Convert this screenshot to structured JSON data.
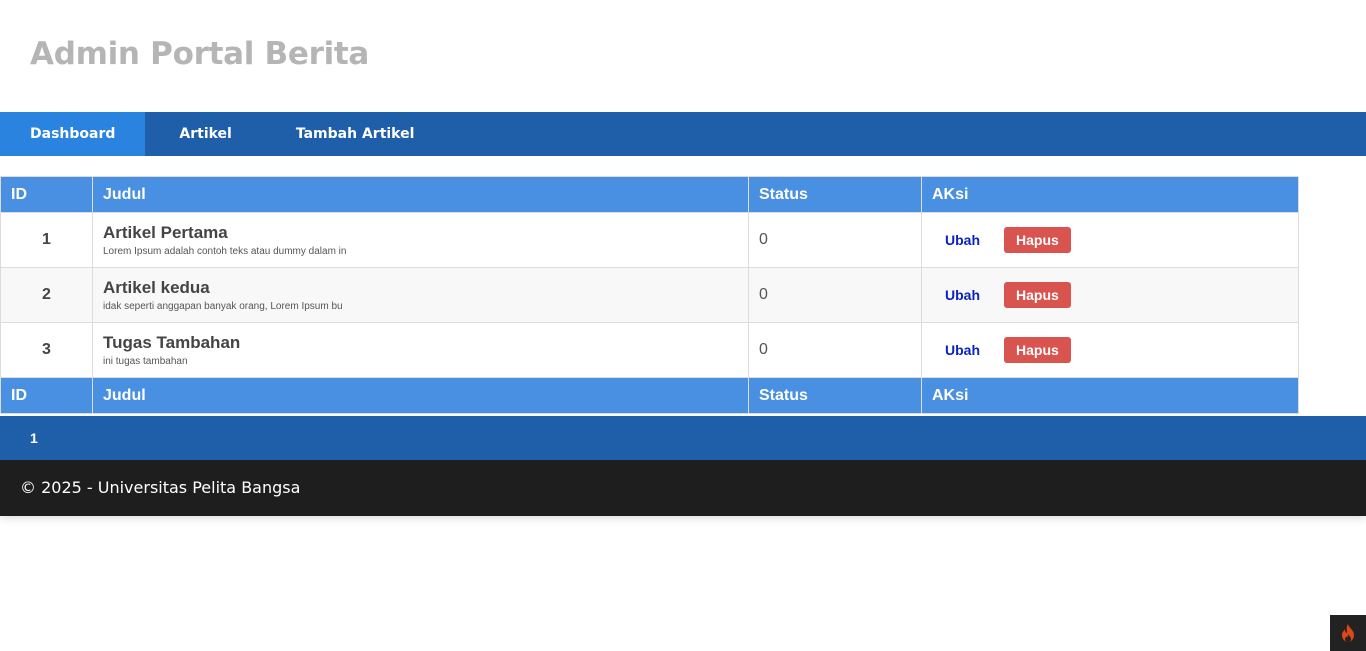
{
  "header": {
    "title": "Admin Portal Berita"
  },
  "nav": {
    "items": [
      {
        "label": "Dashboard",
        "active": true
      },
      {
        "label": "Artikel",
        "active": false
      },
      {
        "label": "Tambah Artikel",
        "active": false
      }
    ]
  },
  "table": {
    "headers": [
      "ID",
      "Judul",
      "Status",
      "AKsi"
    ],
    "rows": [
      {
        "id": "1",
        "title": "Artikel Pertama",
        "snippet": "Lorem Ipsum adalah contoh teks atau dummy dalam in",
        "status": "0",
        "edit_label": "Ubah",
        "delete_label": "Hapus"
      },
      {
        "id": "2",
        "title": "Artikel kedua",
        "snippet": "idak seperti anggapan banyak orang, Lorem Ipsum bu",
        "status": "0",
        "edit_label": "Ubah",
        "delete_label": "Hapus"
      },
      {
        "id": "3",
        "title": "Tugas Tambahan",
        "snippet": "ini tugas tambahan",
        "status": "0",
        "edit_label": "Ubah",
        "delete_label": "Hapus"
      }
    ]
  },
  "pagination": {
    "pages": [
      "1"
    ]
  },
  "footer": {
    "text": "© 2025 - Universitas Pelita Bangsa"
  },
  "debug_toolbar": {
    "icon": "flame-icon",
    "color": "#dd4814"
  },
  "colors": {
    "nav_bg": "#1f5faa",
    "nav_active": "#2b83e0",
    "table_header": "#4a90e2",
    "delete_button": "#d9534f",
    "edit_link": "#0b22c0",
    "footer_bg": "#1e1e1e",
    "title_text": "#b5b5b5"
  }
}
